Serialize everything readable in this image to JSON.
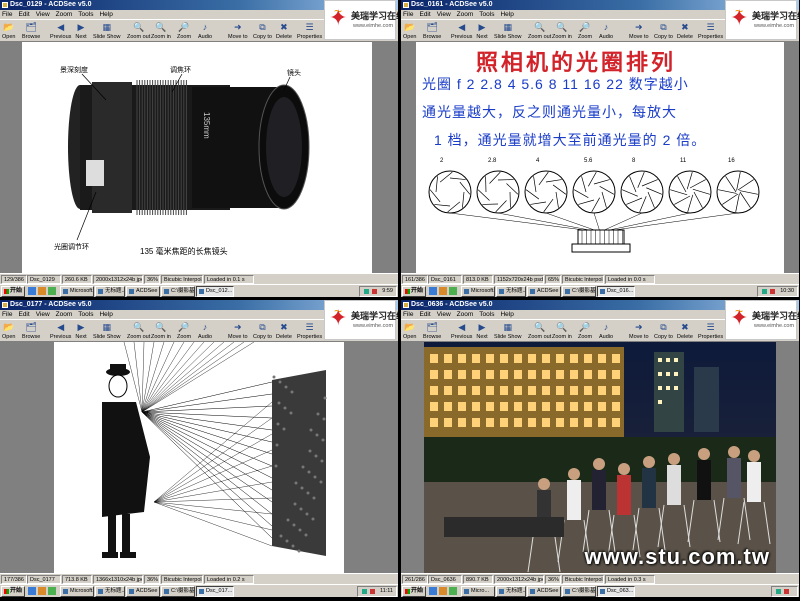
{
  "menu": [
    "File",
    "Edit",
    "View",
    "Zoom",
    "Tools",
    "Help"
  ],
  "toolbar": [
    {
      "label": "Open",
      "icon": "folder-icon"
    },
    {
      "label": "Browse",
      "icon": "browse-icon"
    },
    {
      "label": "Previous",
      "icon": "previous-icon"
    },
    {
      "label": "Next",
      "icon": "next-icon"
    },
    {
      "label": "Slide Show",
      "icon": "slideshow-icon"
    },
    {
      "label": "Zoom out",
      "icon": "zoom-out-icon"
    },
    {
      "label": "Zoom in",
      "icon": "zoom-in-icon"
    },
    {
      "label": "Zoom",
      "icon": "zoom-icon"
    },
    {
      "label": "Audio",
      "icon": "audio-icon"
    },
    {
      "label": "Move to",
      "icon": "move-to-icon"
    },
    {
      "label": "Copy to",
      "icon": "copy-to-icon"
    },
    {
      "label": "Delete",
      "icon": "delete-icon"
    },
    {
      "label": "Properties",
      "icon": "properties-icon"
    },
    {
      "label": "Help",
      "icon": "help-icon"
    },
    {
      "label": "What's This?",
      "icon": "whats-this-icon"
    }
  ],
  "logo": {
    "name": "美瑞学习在线",
    "url": "www.eimhe.com"
  },
  "start_label": "开始",
  "watermark": "www.stu.com.tw",
  "windows": [
    {
      "title": "Dsc_0129 - ACDSee v5.0",
      "status": [
        "129/386",
        "Dsc_0129",
        "260.6 KB",
        "2000x1312x24b jpeg",
        "36%",
        "Bicubic Interpolation",
        "Loaded in 0.1 s"
      ],
      "tasks": [
        "Microsoft...",
        "无标题...",
        "ACDSee ...",
        "C:\\摄影基...",
        "Dsc_012..."
      ],
      "clock": "9:59"
    },
    {
      "title": "Dsc_0161 - ACDSee v5.0",
      "status": [
        "161/386",
        "Dsc_0161",
        "813.0 KB",
        "1152x720x24b psd",
        "65%",
        "Bicubic Interpolation",
        "Loaded in 0.0 s"
      ],
      "tasks": [
        "Microsoft...",
        "无标题...",
        "ACDSee ...",
        "C:\\摄影基...",
        "Dsc_016..."
      ],
      "clock": "10:30"
    },
    {
      "title": "Dsc_0177 - ACDSee v5.0",
      "status": [
        "177/386",
        "Dsc_0177",
        "713.8 KB",
        "1366x1310x24b jpeg",
        "36%",
        "Bicubic Interpolation",
        "Loaded in 0.2 s"
      ],
      "tasks": [
        "Microsoft...",
        "无标题...",
        "ACDSee ...",
        "C:\\摄影基...",
        "Dsc_017..."
      ],
      "clock": "11:11"
    },
    {
      "title": "Dsc_0636 - ACDSee v5.0",
      "status": [
        "261/286",
        "Dsc_0636",
        "890.7 KB",
        "2000x1312x24b jpeg",
        "36%",
        "Bicubic Interpolation",
        "Loaded in 0.3 s"
      ],
      "tasks": [
        "Micro...",
        "无标题...",
        "ACDSee ...",
        "C:\\摄影基...",
        "Dsc_063..."
      ],
      "clock": ""
    }
  ],
  "lens_image": {
    "labels": [
      "景深刻度",
      "调焦环",
      "镜头",
      "光圈调节环",
      "135 毫米焦距的长焦镜头"
    ],
    "lens_markings": [
      "NIKKOR",
      "135mm",
      "1:2.8",
      "959452"
    ]
  },
  "aperture_image": {
    "title": "照相机的光圈排列",
    "lines": [
      "光圈 f 2 2.8 4 5.6 8 11 16 22 数字越小",
      "通光量越大，反之则通光量小，每放大",
      "1 档，通光量就增大至前通光量的 2 倍。"
    ],
    "stops": [
      "2",
      "2.8",
      "4",
      "5.6",
      "8",
      "11",
      "16"
    ]
  },
  "colors": {
    "titlebar": "#0a246a",
    "titlebar_end": "#a6caf0",
    "chrome": "#d4d0c8",
    "viewer_bg": "#808080",
    "title_red": "#d2232a",
    "text_blue": "#1a3cc8"
  }
}
